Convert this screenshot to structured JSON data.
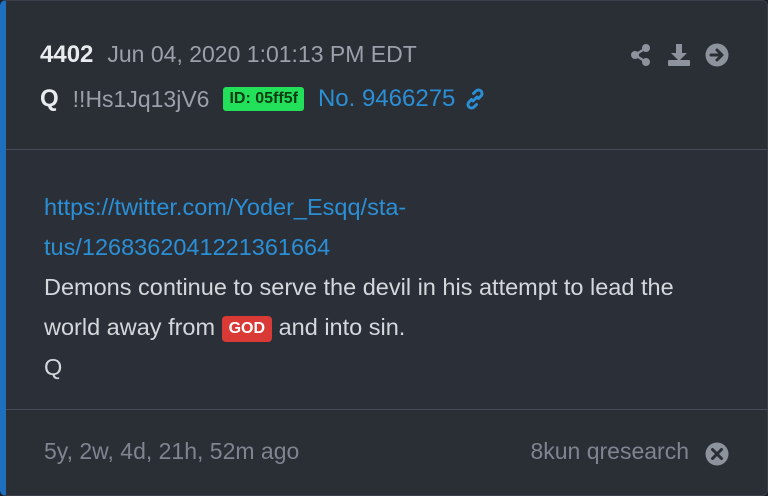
{
  "post": {
    "number": "4402",
    "date": "Jun 04, 2020 1:01:13 PM EDT",
    "author": "Q",
    "tripcode": "!!Hs1Jq13jV6",
    "id_badge": "ID: 05ff5f",
    "post_no": "No. 9466275",
    "url_line1": "https://twitter.com/Yoder_Esqq/sta-",
    "url_line2": "tus/1268362041221361664",
    "text_line1": "Demons continue to serve the devil in his attempt to lead the",
    "text_line2_a": "world away from",
    "highlight": "GOD",
    "text_line2_b": "and into sin.",
    "signature": "Q"
  },
  "footer": {
    "age": "5y, 2w, 4d, 21h, 52m ago",
    "board": "8kun qresearch"
  },
  "colors": {
    "accent": "#2b8fd6",
    "id_badge": "#22e05a",
    "god_badge": "#d93a36",
    "left_border": "#1f6fbf"
  },
  "icons": [
    "share-icon",
    "download-icon",
    "arrow-right-circle-icon",
    "link-icon",
    "close-circle-icon"
  ]
}
